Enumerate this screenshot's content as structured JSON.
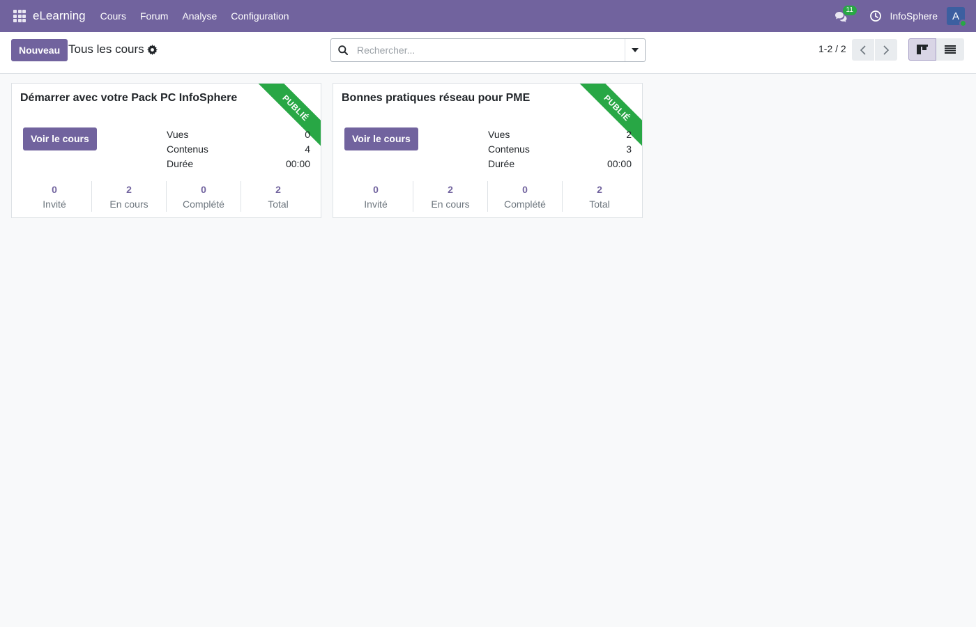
{
  "navbar": {
    "app_name": "eLearning",
    "menu": [
      "Cours",
      "Forum",
      "Analyse",
      "Configuration"
    ],
    "message_count": "11",
    "company": "InfoSphere",
    "avatar_letter": "A"
  },
  "control": {
    "new_label": "Nouveau",
    "title": "Tous les cours",
    "search_placeholder": "Rechercher...",
    "pager": "1-2 / 2"
  },
  "cards": [
    {
      "title": "Démarrer avec votre Pack PC InfoSphere",
      "ribbon": "PUBLIÉ",
      "button_label": "Voir le cours",
      "stats": [
        {
          "label": "Vues",
          "value": "0"
        },
        {
          "label": "Contenus",
          "value": "4"
        },
        {
          "label": "Durée",
          "value": "00:00"
        }
      ],
      "counters": [
        {
          "value": "0",
          "label": "Invité"
        },
        {
          "value": "2",
          "label": "En cours"
        },
        {
          "value": "0",
          "label": "Complété"
        },
        {
          "value": "2",
          "label": "Total"
        }
      ]
    },
    {
      "title": "Bonnes pratiques réseau pour PME",
      "ribbon": "PUBLIÉ",
      "button_label": "Voir le cours",
      "stats": [
        {
          "label": "Vues",
          "value": "2"
        },
        {
          "label": "Contenus",
          "value": "3"
        },
        {
          "label": "Durée",
          "value": "00:00"
        }
      ],
      "counters": [
        {
          "value": "0",
          "label": "Invité"
        },
        {
          "value": "2",
          "label": "En cours"
        },
        {
          "value": "0",
          "label": "Complété"
        },
        {
          "value": "2",
          "label": "Total"
        }
      ]
    }
  ],
  "colors": {
    "brand": "#71639e",
    "ribbon": "#28a745",
    "badge": "#28a745",
    "background": "#f8f9fa"
  }
}
